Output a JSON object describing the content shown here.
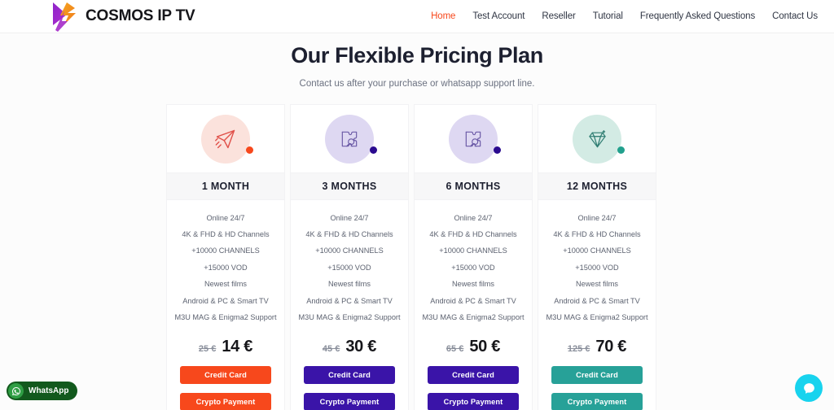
{
  "header": {
    "brand_name": "COSMOS IP TV",
    "logo_icon": "lightning-bolt-play-logo",
    "nav": [
      {
        "label": "Home",
        "active": true
      },
      {
        "label": "Test Account",
        "active": false
      },
      {
        "label": "Reseller",
        "active": false
      },
      {
        "label": "Tutorial",
        "active": false
      },
      {
        "label": "Frequently Asked Questions",
        "active": false
      },
      {
        "label": "Contact Us",
        "active": false
      }
    ]
  },
  "hero": {
    "title": "Our Flexible Pricing Plan",
    "subtitle": "Contact us after your purchase or whatsapp support line."
  },
  "pricing": {
    "features": [
      "Online 24/7",
      "4K & FHD & HD Channels",
      "+10000 CHANNELS",
      "+15000 VOD",
      "Newest films",
      "Android & PC & Smart TV",
      "M3U MAG & Enigma2 Support"
    ],
    "plans": [
      {
        "title": "1 MONTH",
        "icon": "paper-plane-icon",
        "bubble_color": "#fbe2dc",
        "accent": "#f7481c",
        "dot_color": "#f7481c",
        "price_old": "25 €",
        "price_new": "14 €",
        "credit_label": "Credit Card",
        "crypto_label": "Crypto Payment",
        "button_color": "#f7481c"
      },
      {
        "title": "3 MONTHS",
        "icon": "puzzle-piece-icon",
        "bubble_color": "#ded8f2",
        "accent": "#6c5ba7",
        "dot_color": "#2a0a8f",
        "price_old": "45 €",
        "price_new": "30 €",
        "credit_label": "Credit Card",
        "crypto_label": "Crypto Payment",
        "button_color": "#3a14a8"
      },
      {
        "title": "6 MONTHS",
        "icon": "puzzle-piece-icon",
        "bubble_color": "#ded8f2",
        "accent": "#6c5ba7",
        "dot_color": "#2a0a8f",
        "price_old": "65 €",
        "price_new": "50 €",
        "credit_label": "Credit Card",
        "crypto_label": "Crypto Payment",
        "button_color": "#3a14a8"
      },
      {
        "title": "12 MONTHS",
        "icon": "diamond-icon",
        "bubble_color": "#d3ebe4",
        "accent": "#2f7d72",
        "dot_color": "#21a08d",
        "price_old": "125 €",
        "price_new": "70 €",
        "credit_label": "Credit Card",
        "crypto_label": "Crypto Payment",
        "button_color": "#27a198"
      }
    ]
  },
  "widgets": {
    "whatsapp_label": "WhatsApp",
    "whatsapp_icon": "whatsapp-icon",
    "chat_icon": "chat-bubble-icon"
  }
}
